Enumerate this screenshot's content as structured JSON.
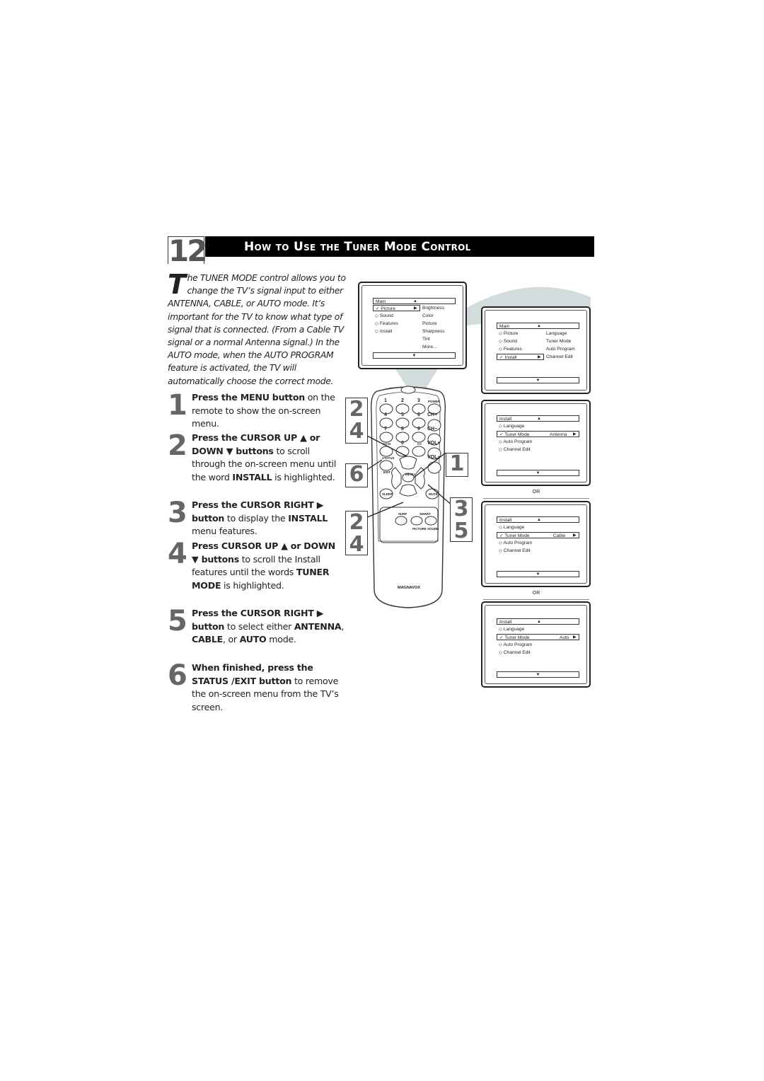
{
  "header": {
    "page_number": "12",
    "title": "How to Use the Tuner Mode Control"
  },
  "intro": {
    "dropcap": "T",
    "text": "he TUNER MODE control allows you to change the TV’s signal input to either ANTENNA, CABLE, or AUTO mode. It’s important for the TV to know what type of signal that is connected. (From a Cable TV signal or a normal Antenna signal.) In the AUTO mode, when the AUTO PROGRAM feature is activated, the TV will automatically choose the correct mode."
  },
  "steps": [
    {
      "num": "1",
      "bold": "Press the MENU button",
      "rest": " on the remote to show the on-screen menu."
    },
    {
      "num": "2",
      "bold": "Press the CURSOR UP ▲ or DOWN ▼ buttons",
      "rest": " to scroll through the on-screen menu until the word ",
      "bold2": "INSTALL",
      "rest2": " is highlighted."
    },
    {
      "num": "3",
      "bold": "Press the CURSOR RIGHT ▶ button",
      "rest": " to display the ",
      "bold2": "INSTALL",
      "rest2": " menu features."
    },
    {
      "num": "4",
      "bold": "Press CURSOR UP ▲ or DOWN ▼ buttons",
      "rest": " to scroll the Install features until the words ",
      "bold2": "TUNER MODE",
      "rest2": " is highlighted."
    },
    {
      "num": "5",
      "bold": "Press the CURSOR RIGHT ▶ button",
      "rest": " to select either ",
      "bold2": "ANTENNA",
      "rest2": ", ",
      "bold3": "CABLE",
      "rest3": ", or ",
      "bold4": "AUTO",
      "rest4": " mode."
    },
    {
      "num": "6",
      "bold": "When finished, press the STATUS /EXIT button",
      "rest": " to remove the on-screen menu from the TV’s screen."
    }
  ],
  "screens": {
    "main_picture": {
      "header": "Main",
      "items": [
        "Picture",
        "Sound",
        "Features",
        "Install"
      ],
      "selected": "Picture",
      "sub_items": [
        "Brightness",
        "Color",
        "Picture",
        "Sharpness",
        "Tint",
        "More..."
      ]
    },
    "main_install": {
      "header": "Main",
      "items": [
        "Picture",
        "Sound",
        "Features",
        "Install"
      ],
      "selected": "Install",
      "sub_items": [
        "Language",
        "Tuner Mode",
        "Auto Program",
        "Channel Edit"
      ]
    },
    "install_antenna": {
      "header": "Install",
      "items": [
        "Language",
        "Tuner Mode",
        "Auto Program",
        "Channel Edit"
      ],
      "selected": "Tuner Mode",
      "value": "Antenna"
    },
    "install_cable": {
      "header": "Install",
      "items": [
        "Language",
        "Tuner Mode",
        "Auto Program",
        "Channel Edit"
      ],
      "selected": "Tuner Mode",
      "value": "Cable"
    },
    "install_auto": {
      "header": "Install",
      "items": [
        "Language",
        "Tuner Mode",
        "Auto Program",
        "Channel Edit"
      ],
      "selected": "Tuner Mode",
      "value": "Auto"
    },
    "or_label": "OR"
  },
  "remote": {
    "brand": "MAGNAVOX",
    "number_keys": [
      "1",
      "2",
      "3",
      "4",
      "5",
      "6",
      "7",
      "8",
      "9",
      "0"
    ],
    "labels": {
      "power": "POWER",
      "ch_up": "CH+",
      "ch_down": "CH−",
      "vol_up": "VOL+",
      "vol_down": "VOL−",
      "ach": "A/CH",
      "cc": "CC",
      "status": "STATUS",
      "exit": "EXIT",
      "menu": "MENU",
      "sleep": "SLEEP",
      "mute": "MUTE",
      "surf": "SURF",
      "smart": "SMART",
      "picture": "PICTURE",
      "sound": "SOUND"
    },
    "callouts": {
      "up_down_top": [
        "2",
        "4"
      ],
      "status": "6",
      "menu": "1",
      "right": [
        "3",
        "5"
      ],
      "up_down_bottom": [
        "2",
        "4"
      ]
    }
  },
  "colors": {
    "beam": "#d3dcdd",
    "callout_digit": "#666666",
    "title_bar": "#000000"
  }
}
